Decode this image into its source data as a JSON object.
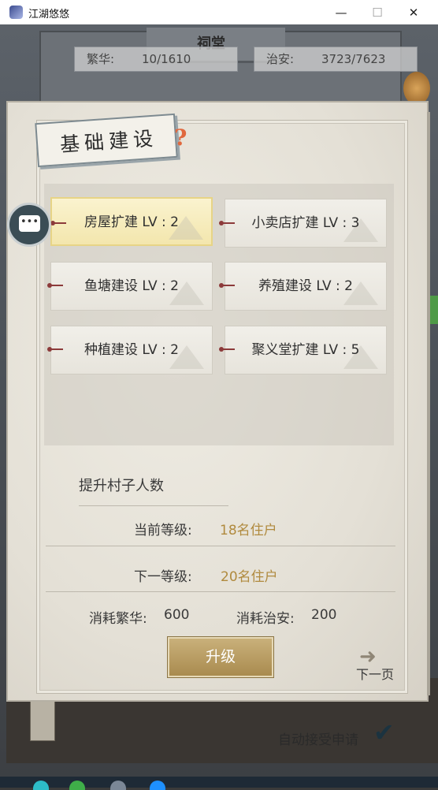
{
  "window": {
    "title": "江湖悠悠"
  },
  "header": {
    "sign_text": "祠堂",
    "prosperity_label": "繁华:",
    "prosperity_value": "10/1610",
    "security_label": "治安:",
    "security_value": "3723/7623"
  },
  "panel": {
    "title": "基础建设",
    "help_glyph": "?",
    "buildings": [
      {
        "label": "房屋扩建 LV : 2",
        "selected": true
      },
      {
        "label": "小卖店扩建 LV : 3"
      },
      {
        "label": "鱼塘建设 LV : 2"
      },
      {
        "label": "养殖建设 LV : 2"
      },
      {
        "label": "种植建设 LV : 2"
      },
      {
        "label": "聚义堂扩建 LV : 5"
      }
    ],
    "description": "提升村子人数",
    "current_level_label": "当前等级:",
    "current_level_value": "18名住户",
    "next_level_label": "下一等级:",
    "next_level_value": "20名住户",
    "cost_prosperity_label": "消耗繁华:",
    "cost_prosperity_value": "600",
    "cost_security_label": "消耗治安:",
    "cost_security_value": "200",
    "upgrade_button": "升级",
    "next_page": "下一页"
  },
  "footer": {
    "auto_accept_label": "自动接受申请"
  },
  "colors": {
    "accent_gold": "#b08a3e",
    "button": "#b89a5e",
    "selected_card": "#f6ecbd"
  }
}
